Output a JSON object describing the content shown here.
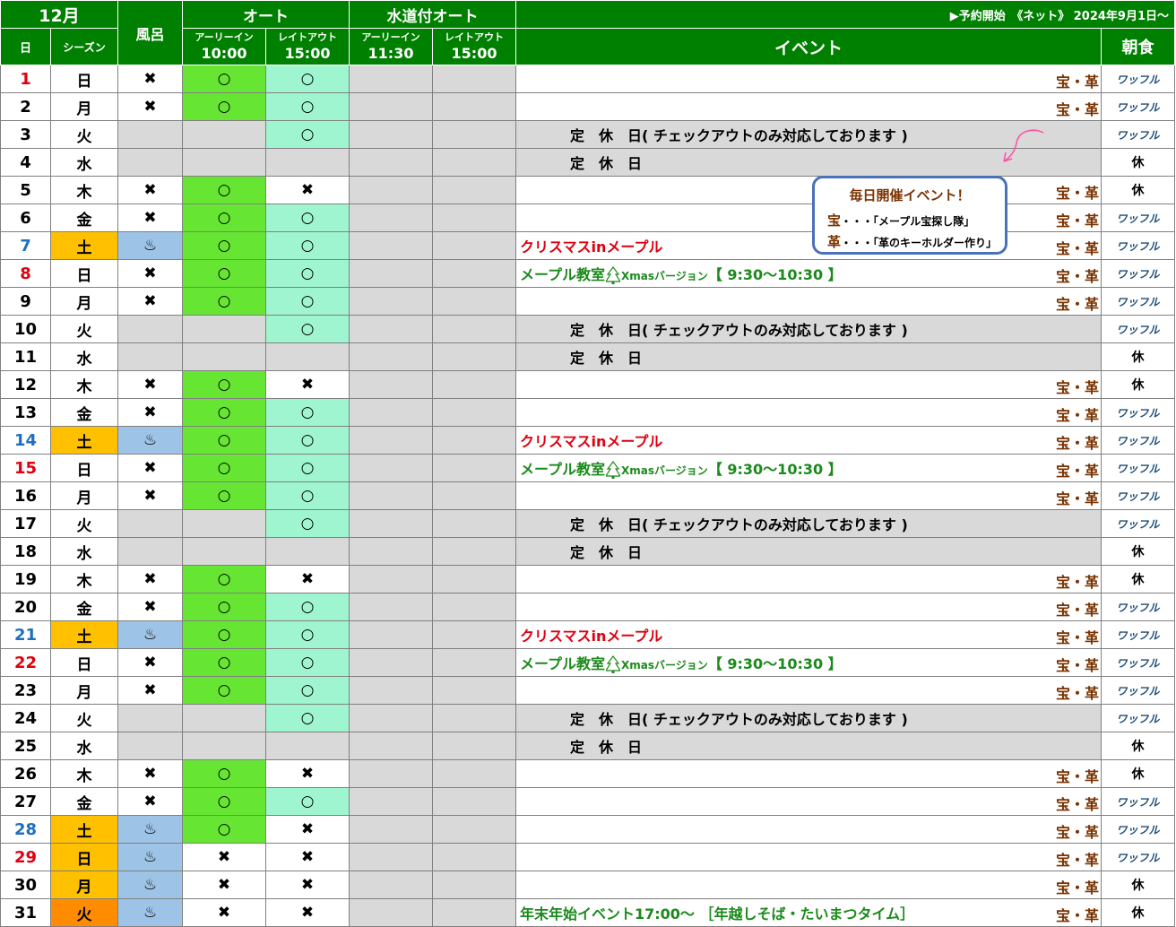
{
  "header": {
    "month": "12月",
    "bath": "風呂",
    "auto": "オート",
    "water_auto": "水道付オート",
    "reservation": "▶予約開始　《ネット》 2024年9月1日～",
    "day": "日",
    "season": "シーズン",
    "event": "イベント",
    "breakfast": "朝食",
    "early_in": "アーリーイン",
    "late_out": "レイトアウト",
    "auto_early_time": "10:00",
    "auto_late_time": "15:00",
    "water_early_time": "11:30",
    "water_late_time": "15:00"
  },
  "marks": {
    "circle": "○",
    "cross": "✖",
    "bath": "♨"
  },
  "ticket": "宝・革",
  "breakfast_labels": {
    "waffle": "ワッフル",
    "closed": "休"
  },
  "events": {
    "closed_checkout": "定　休　日( チェックアウトのみ対応しております )",
    "closed": "定　休　日",
    "christmas": "クリスマスinメープル",
    "classroom_a": "メープル教室",
    "classroom_b": "Xmasバージョン",
    "classroom_c": "【 9:30～10:30 】",
    "new_year": "年末年始イベント17:00～ ［年越しそば・たいまつタイム］"
  },
  "note": {
    "title": "毎日開催イベント！",
    "line1_key": "宝",
    "line1_text": "・・・「メープル宝探し隊」",
    "line2_key": "革",
    "line2_text": "・・・「革のキーホルダー作り」"
  },
  "colors": {
    "header_green": "#008000",
    "early_green": "#66e633",
    "late_mint": "#9ff5cf",
    "closed_gray": "#d9d9d9",
    "weekend_orange": "#ffc000",
    "eve_orange": "#ff8c00",
    "bath_blue": "#9dc3e6"
  },
  "rows": [
    {
      "day": "1",
      "dc": "red",
      "wd": "日",
      "bath": "x",
      "e": "o",
      "l": "o",
      "ev": "none",
      "tk": true,
      "bf": "w"
    },
    {
      "day": "2",
      "dc": "",
      "wd": "月",
      "bath": "x",
      "e": "o",
      "l": "o",
      "ev": "none",
      "tk": true,
      "bf": "w"
    },
    {
      "day": "3",
      "dc": "",
      "wd": "火",
      "bath": "-",
      "e": "-",
      "l": "o",
      "ev": "cc",
      "tk": false,
      "bf": "w"
    },
    {
      "day": "4",
      "dc": "",
      "wd": "水",
      "bath": "-",
      "e": "-",
      "l": "-",
      "ev": "c",
      "tk": false,
      "bf": "r"
    },
    {
      "day": "5",
      "dc": "",
      "wd": "木",
      "bath": "x",
      "e": "o",
      "l": "x",
      "ev": "none",
      "tk": true,
      "bf": "r"
    },
    {
      "day": "6",
      "dc": "",
      "wd": "金",
      "bath": "x",
      "e": "o",
      "l": "o",
      "ev": "none",
      "tk": true,
      "bf": "w"
    },
    {
      "day": "7",
      "dc": "blue",
      "wd": "土",
      "bath": "b",
      "e": "o",
      "l": "o",
      "ev": "x",
      "tk": true,
      "bf": "w"
    },
    {
      "day": "8",
      "dc": "red",
      "wd": "日",
      "bath": "x",
      "e": "o",
      "l": "o",
      "ev": "m",
      "tk": true,
      "bf": "w"
    },
    {
      "day": "9",
      "dc": "",
      "wd": "月",
      "bath": "x",
      "e": "o",
      "l": "o",
      "ev": "none",
      "tk": true,
      "bf": "w"
    },
    {
      "day": "10",
      "dc": "",
      "wd": "火",
      "bath": "-",
      "e": "-",
      "l": "o",
      "ev": "cc",
      "tk": false,
      "bf": "w"
    },
    {
      "day": "11",
      "dc": "",
      "wd": "水",
      "bath": "-",
      "e": "-",
      "l": "-",
      "ev": "c",
      "tk": false,
      "bf": "r"
    },
    {
      "day": "12",
      "dc": "",
      "wd": "木",
      "bath": "x",
      "e": "o",
      "l": "x",
      "ev": "none",
      "tk": true,
      "bf": "r"
    },
    {
      "day": "13",
      "dc": "",
      "wd": "金",
      "bath": "x",
      "e": "o",
      "l": "o",
      "ev": "none",
      "tk": true,
      "bf": "w"
    },
    {
      "day": "14",
      "dc": "blue",
      "wd": "土",
      "bath": "b",
      "e": "o",
      "l": "o",
      "ev": "x",
      "tk": true,
      "bf": "w"
    },
    {
      "day": "15",
      "dc": "red",
      "wd": "日",
      "bath": "x",
      "e": "o",
      "l": "o",
      "ev": "m",
      "tk": true,
      "bf": "w"
    },
    {
      "day": "16",
      "dc": "",
      "wd": "月",
      "bath": "x",
      "e": "o",
      "l": "o",
      "ev": "none",
      "tk": true,
      "bf": "w"
    },
    {
      "day": "17",
      "dc": "",
      "wd": "火",
      "bath": "-",
      "e": "-",
      "l": "o",
      "ev": "cc",
      "tk": false,
      "bf": "w"
    },
    {
      "day": "18",
      "dc": "",
      "wd": "水",
      "bath": "-",
      "e": "-",
      "l": "-",
      "ev": "c",
      "tk": false,
      "bf": "r"
    },
    {
      "day": "19",
      "dc": "",
      "wd": "木",
      "bath": "x",
      "e": "o",
      "l": "x",
      "ev": "none",
      "tk": true,
      "bf": "r"
    },
    {
      "day": "20",
      "dc": "",
      "wd": "金",
      "bath": "x",
      "e": "o",
      "l": "o",
      "ev": "none",
      "tk": true,
      "bf": "w"
    },
    {
      "day": "21",
      "dc": "blue",
      "wd": "土",
      "bath": "b",
      "e": "o",
      "l": "o",
      "ev": "x",
      "tk": true,
      "bf": "w"
    },
    {
      "day": "22",
      "dc": "red",
      "wd": "日",
      "bath": "x",
      "e": "o",
      "l": "o",
      "ev": "m",
      "tk": true,
      "bf": "w"
    },
    {
      "day": "23",
      "dc": "",
      "wd": "月",
      "bath": "x",
      "e": "o",
      "l": "o",
      "ev": "none",
      "tk": true,
      "bf": "w"
    },
    {
      "day": "24",
      "dc": "",
      "wd": "火",
      "bath": "-",
      "e": "-",
      "l": "o",
      "ev": "cc",
      "tk": false,
      "bf": "w"
    },
    {
      "day": "25",
      "dc": "",
      "wd": "水",
      "bath": "-",
      "e": "-",
      "l": "-",
      "ev": "c",
      "tk": false,
      "bf": "r"
    },
    {
      "day": "26",
      "dc": "",
      "wd": "木",
      "bath": "x",
      "e": "o",
      "l": "x",
      "ev": "none",
      "tk": true,
      "bf": "r"
    },
    {
      "day": "27",
      "dc": "",
      "wd": "金",
      "bath": "x",
      "e": "o",
      "l": "o",
      "ev": "none",
      "tk": true,
      "bf": "w"
    },
    {
      "day": "28",
      "dc": "blue",
      "wd": "土",
      "bath": "b",
      "e": "o",
      "l": "x",
      "ev": "none",
      "tk": true,
      "bf": "w"
    },
    {
      "day": "29",
      "dc": "red",
      "wd": "日",
      "bath": "b",
      "e": "x",
      "l": "x",
      "ev": "none",
      "tk": true,
      "bf": "w"
    },
    {
      "day": "30",
      "dc": "",
      "wd": "月",
      "bath": "b",
      "e": "x",
      "l": "x",
      "ev": "none",
      "tk": true,
      "bf": "r"
    },
    {
      "day": "31",
      "dc": "",
      "wd": "火",
      "bath": "b",
      "e": "x",
      "l": "x",
      "ev": "ny",
      "tk": true,
      "bf": "r"
    }
  ]
}
